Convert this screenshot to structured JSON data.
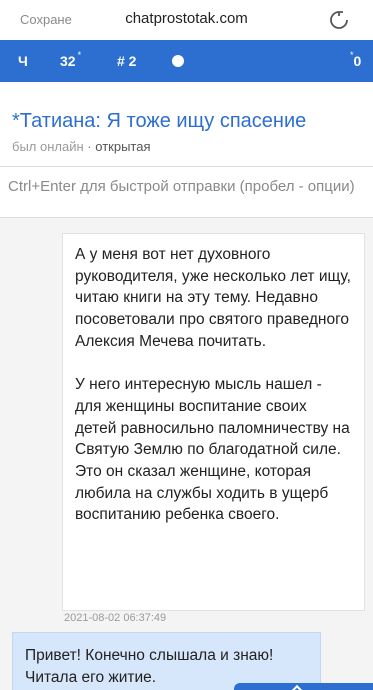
{
  "browser": {
    "left_label": "Сохране",
    "url": "chatprostotak.com"
  },
  "nav": {
    "item1": "Ч",
    "item2_count": "32",
    "item2_mark": "*",
    "item3": "# 2",
    "item4_mark": "*",
    "item4_count": "0"
  },
  "chat": {
    "title": "*Татиана: Я тоже ищу спасение",
    "status": "был онлайн",
    "separator": "·",
    "openness": "открытая"
  },
  "compose": {
    "placeholder": "Ctrl+Enter для быстрой отправки (пробел - опции)"
  },
  "messages": [
    {
      "side": "mine",
      "paragraphs": [
        "А у меня вот нет духовного руководителя, уже несколько лет ищу, читаю книги на эту тему. Недавно посоветовали про святого праведного Алексия Мечева почитать.",
        "У него интересную мысль нашел - для женщины воспитание своих детей равносильно паломничеству на Святую Землю по благодатной силе. Это он сказал женщине, которая любила на службы ходить в ущерб воспитанию ребенка своего."
      ],
      "time": "2021-08-02 06:37:49"
    },
    {
      "side": "theirs",
      "text": "Привет! Конечно слышала и знаю! Читала его житие."
    }
  ],
  "colors": {
    "accent": "#2c6fd1",
    "bubble_theirs": "#d6e6fb"
  },
  "icons": {
    "reload": "reload-icon",
    "online_dot": "dot-icon",
    "scroll": "chevron-up-icon"
  }
}
